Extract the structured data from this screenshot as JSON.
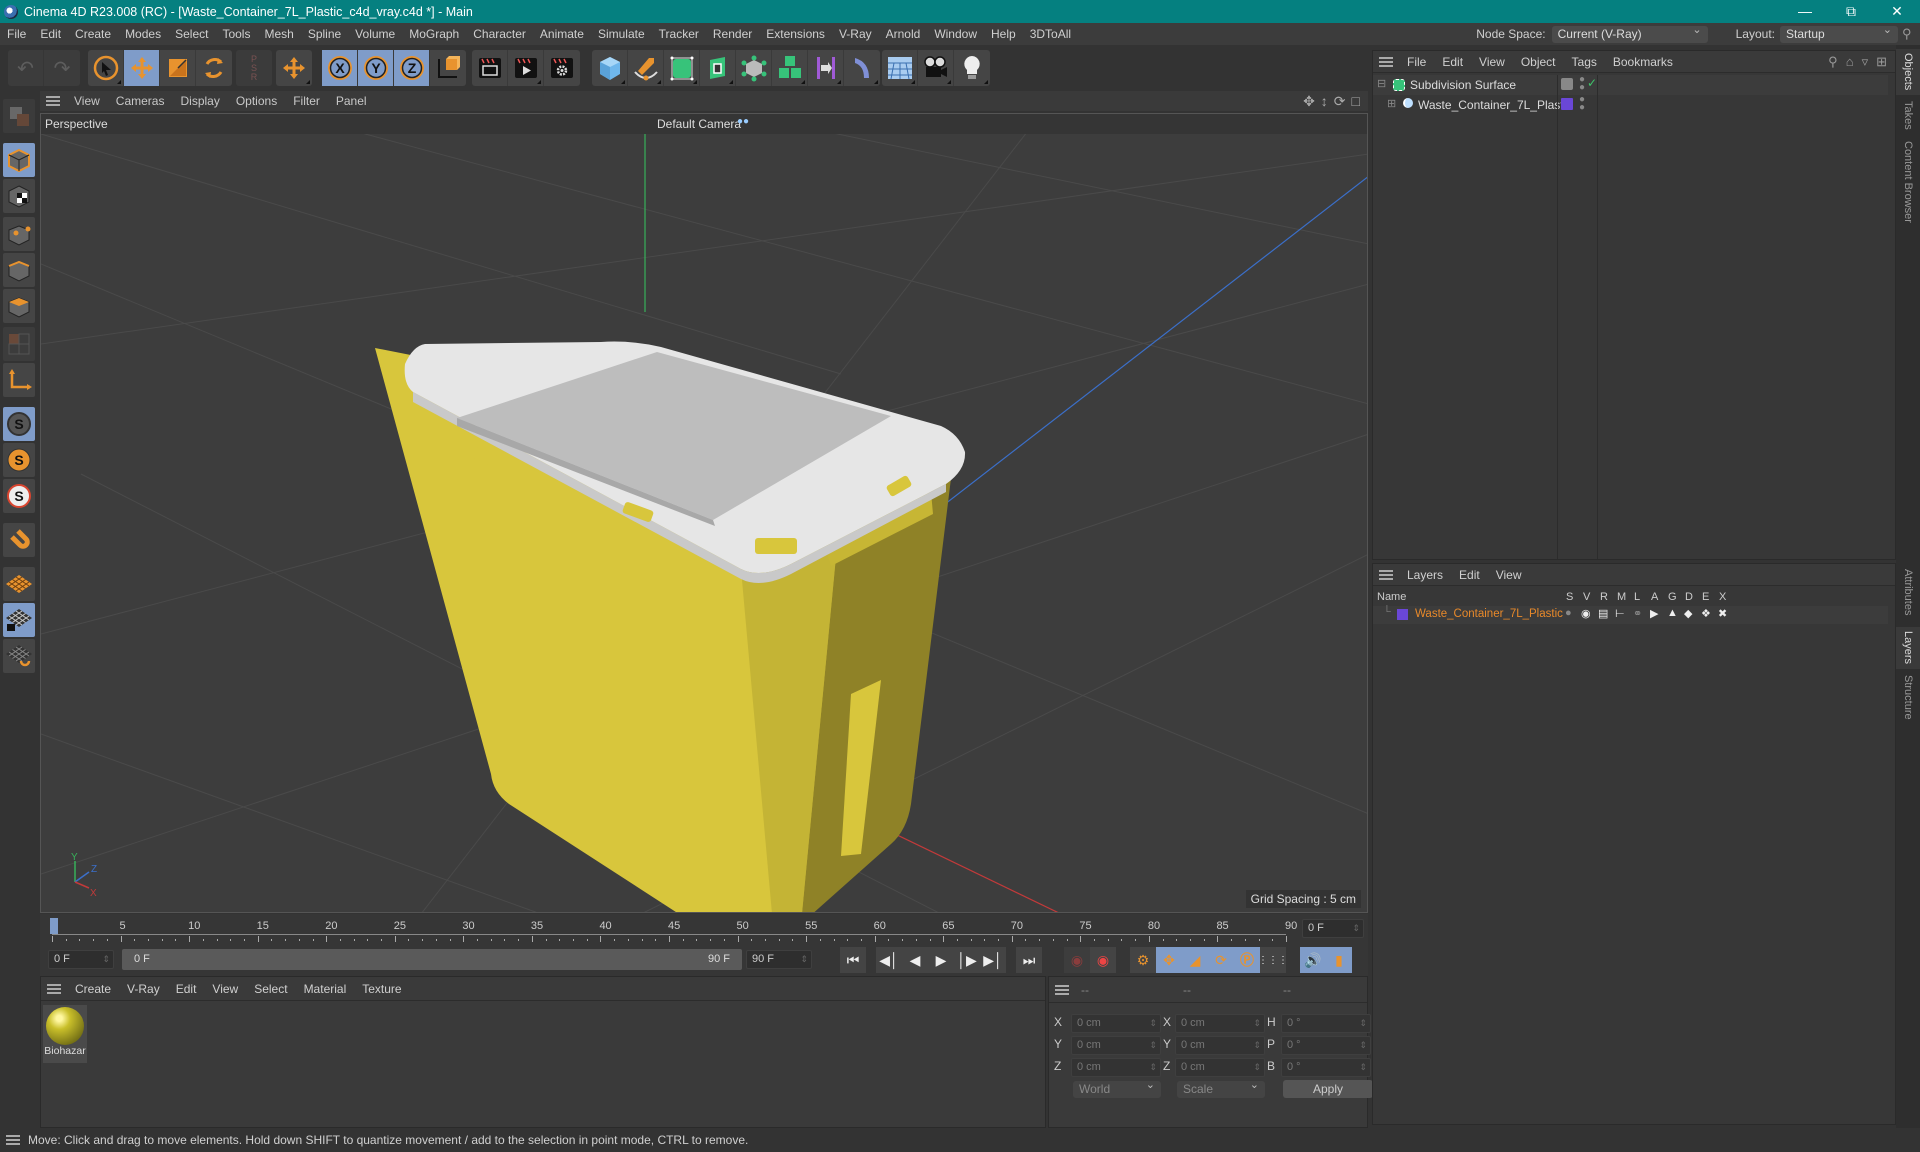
{
  "window": {
    "title": "Cinema 4D R23.008 (RC) - [Waste_Container_7L_Plastic_c4d_vray.c4d *] - Main",
    "controls": [
      "minimize",
      "restore",
      "close"
    ]
  },
  "menubar": {
    "items": [
      "File",
      "Edit",
      "Create",
      "Modes",
      "Select",
      "Tools",
      "Mesh",
      "Spline",
      "Volume",
      "MoGraph",
      "Character",
      "Animate",
      "Simulate",
      "Tracker",
      "Render",
      "Extensions",
      "V-Ray",
      "Arnold",
      "Window",
      "Help",
      "3DToAll"
    ],
    "node_space_label": "Node Space:",
    "node_space_value": "Current (V-Ray)",
    "layout_label": "Layout:",
    "layout_value": "Startup"
  },
  "toolbar": {
    "groups": [
      [
        "undo-icon",
        "redo-icon"
      ],
      [
        "select-cursor-icon",
        "move-icon",
        "scale-icon",
        "rotate-icon"
      ],
      [
        "psr-icon"
      ],
      [
        "transform-icon"
      ],
      [
        "x-axis-icon",
        "y-axis-icon",
        "z-axis-icon",
        "coordinate-system-icon"
      ],
      [
        "render-view-icon",
        "render-picture-viewer-icon",
        "render-settings-icon"
      ],
      [
        "cube-icon",
        "pen-spline-icon",
        "subdivision-icon",
        "extrude-icon",
        "cloner-icon",
        "mograph-icon",
        "deformer-icon",
        "bend-icon"
      ],
      [
        "floor-icon",
        "camera-icon",
        "light-icon"
      ]
    ],
    "labels": {
      "x": "X",
      "y": "Y",
      "z": "Z"
    }
  },
  "left_tools": [
    "make-editable-icon",
    "model-mode-icon",
    "texture-mode-icon",
    "point-mode-icon",
    "edge-mode-icon",
    "polygon-mode-icon",
    "uv-mode-icon",
    "axis-icon",
    "snap-icon",
    "snap-settings-icon",
    "soft-selection-icon",
    "magnet-icon",
    "workplane-icon",
    "workplane-lock-icon",
    "workplane-align-icon"
  ],
  "viewport": {
    "menu": [
      "View",
      "Cameras",
      "Display",
      "Options",
      "Filter",
      "Panel"
    ],
    "name": "Perspective",
    "camera": "Default Camera",
    "grid_spacing": "Grid Spacing : 5 cm",
    "axis_labels": {
      "x": "X",
      "y": "Y",
      "z": "Z"
    },
    "colors": {
      "body": "#d8c63c",
      "lid": "#d9d9d9",
      "x_axis": "#c23a3a",
      "y_axis": "#37b05a",
      "z_axis": "#3b6fc9"
    }
  },
  "timeline": {
    "ticks": [
      "0",
      "5",
      "10",
      "15",
      "20",
      "25",
      "30",
      "35",
      "40",
      "45",
      "50",
      "55",
      "60",
      "65",
      "70",
      "75",
      "80",
      "85",
      "90"
    ],
    "current_frame": "0 F",
    "start_field": "0 F",
    "range_start": "0 F",
    "range_end": "90 F",
    "end_field": "90 F",
    "max_frame": 90,
    "playhead_frame": 0
  },
  "materials": {
    "menu": [
      "Create",
      "V-Ray",
      "Edit",
      "View",
      "Select",
      "Material",
      "Texture"
    ],
    "items": [
      {
        "name": "Biohazar"
      }
    ]
  },
  "coordinates": {
    "headers": [
      "--",
      "--",
      "--"
    ],
    "rows": [
      {
        "l1": "X",
        "v1": "0 cm",
        "l2": "X",
        "v2": "0 cm",
        "l3": "H",
        "v3": "0 °"
      },
      {
        "l1": "Y",
        "v1": "0 cm",
        "l2": "Y",
        "v2": "0 cm",
        "l3": "P",
        "v3": "0 °"
      },
      {
        "l1": "Z",
        "v1": "0 cm",
        "l2": "Z",
        "v2": "0 cm",
        "l3": "B",
        "v3": "0 °"
      }
    ],
    "space": "World",
    "mode": "Scale",
    "apply_label": "Apply"
  },
  "objects_panel": {
    "menu": [
      "File",
      "Edit",
      "View",
      "Object",
      "Tags",
      "Bookmarks"
    ],
    "items": [
      {
        "name": "Subdivision Surface",
        "depth": 0
      },
      {
        "name": "Waste_Container_7L_Plastic",
        "depth": 1,
        "color": "#6a47d6"
      }
    ]
  },
  "layers_panel": {
    "menu": [
      "Layers",
      "Edit",
      "View"
    ],
    "columns": [
      "Name",
      "S",
      "V",
      "R",
      "M",
      "L",
      "A",
      "G",
      "D",
      "E",
      "X"
    ],
    "items": [
      {
        "name": "Waste_Container_7L_Plastic",
        "color": "#6a47d6",
        "name_color": "#e8892a"
      }
    ]
  },
  "right_tabs": {
    "top": [
      "Objects",
      "Takes",
      "Content Browser"
    ],
    "bottom": [
      "Attributes",
      "Layers",
      "Structure"
    ]
  },
  "status": {
    "text": "Move: Click and drag to move elements. Hold down SHIFT to quantize movement / add to the selection in point mode, CTRL to remove."
  }
}
